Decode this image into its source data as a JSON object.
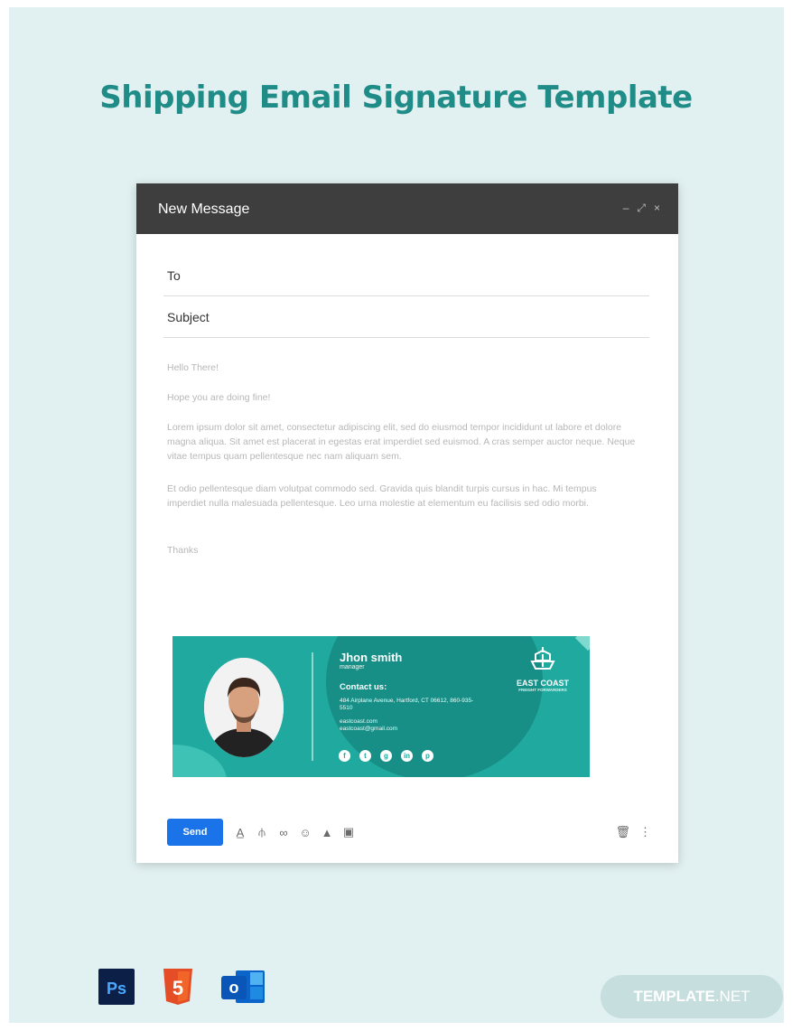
{
  "page": {
    "title": "Shipping Email Signature Template",
    "badge_brand": "TEMPLATE",
    "badge_suffix": ".NET"
  },
  "window": {
    "title": "New Message",
    "controls": [
      "–",
      "⤢",
      "×"
    ]
  },
  "compose": {
    "to_label": "To",
    "subject_label": "Subject",
    "greeting": "Hello There!",
    "opener": "Hope you are doing fine!",
    "paragraph1": "Lorem ipsum dolor sit amet, consectetur adipiscing elit, sed do eiusmod tempor incididunt ut labore et dolore magna aliqua. Sit amet est placerat in egestas erat imperdiet sed euismod. A cras semper auctor neque. Neque vitae tempus quam pellentesque nec nam aliquam sem.",
    "paragraph2": " Et odio pellentesque diam volutpat commodo sed. Gravida quis blandit turpis cursus in hac. Mi tempus imperdiet nulla malesuada pellentesque. Leo urna molestie at elementum eu facilisis sed odio morbi.",
    "closing": "Thanks"
  },
  "signature": {
    "name": "Jhon smith",
    "role": "manager",
    "contact_heading": "Contact us:",
    "address": "484 Airplane Avenue, Hartford, CT 06612, 860-935-5510",
    "website": "eastcoast.com",
    "email": "eastcoast@gmail.com",
    "company_name": "EAST COAST",
    "company_tagline": "FREIGHT FORWARDERS",
    "social_icons": [
      "facebook-icon",
      "twitter-icon",
      "google-plus-icon",
      "linkedin-icon",
      "pinterest-icon"
    ],
    "colors": {
      "primary": "#1fa99f",
      "dark": "#178e86"
    }
  },
  "toolbar": {
    "send_label": "Send",
    "icons": [
      "format-text-icon",
      "attach-icon",
      "link-icon",
      "emoji-icon",
      "drive-icon",
      "image-icon"
    ],
    "right_icons": [
      "trash-icon",
      "more-options-icon"
    ]
  },
  "apps": {
    "photoshop": "Ps",
    "html5": "5",
    "outlook": "o"
  },
  "colors": {
    "title": "#1f8c88",
    "header": "#3e3e3e",
    "send": "#1a73e8"
  }
}
